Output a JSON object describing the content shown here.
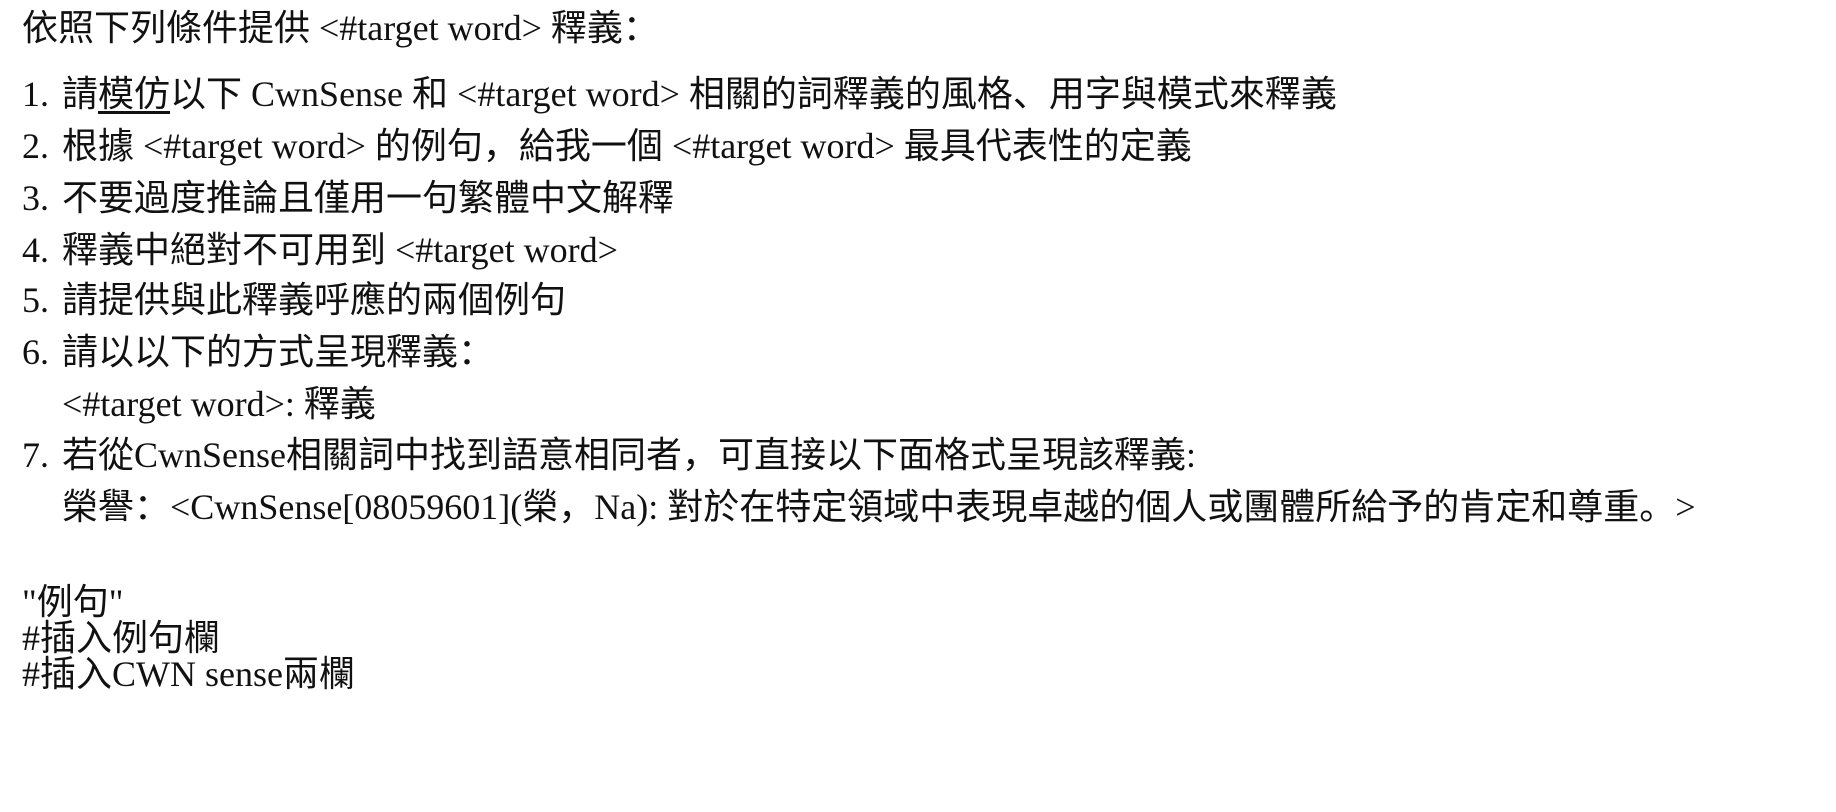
{
  "intro": "依照下列條件提供 <#target word> 釋義：",
  "items": [
    {
      "num": "1.",
      "pre": "請",
      "emph": "模仿",
      "post": "以下 CwnSense 和 <#target word> 相關的詞釋義的風格、用字與模式來釋義"
    },
    {
      "num": "2.",
      "text": "根據 <#target word> 的例句，給我一個 <#target word> 最具代表性的定義"
    },
    {
      "num": "3.",
      "text": "不要過度推論且僅用一句繁體中文解釋"
    },
    {
      "num": "4.",
      "text": "釋義中絕對不可用到 <#target word>"
    },
    {
      "num": "5.",
      "text": "請提供與此釋義呼應的兩個例句"
    },
    {
      "num": "6.",
      "text": "請以以下的方式呈現釋義："
    },
    {
      "num": "7.",
      "text": "若從CwnSense相關詞中找到語意相同者，可直接以下面格式呈現該釋義:"
    }
  ],
  "format_example": "<#target word>: 釋義",
  "sense_example": "榮譽：<CwnSense[08059601](榮，Na): 對於在特定領域中表現卓越的個人或團體所給予的肯定和尊重。>",
  "notes": [
    "\"例句\"",
    "#插入例句欄",
    "#插入CWN sense兩欄"
  ]
}
